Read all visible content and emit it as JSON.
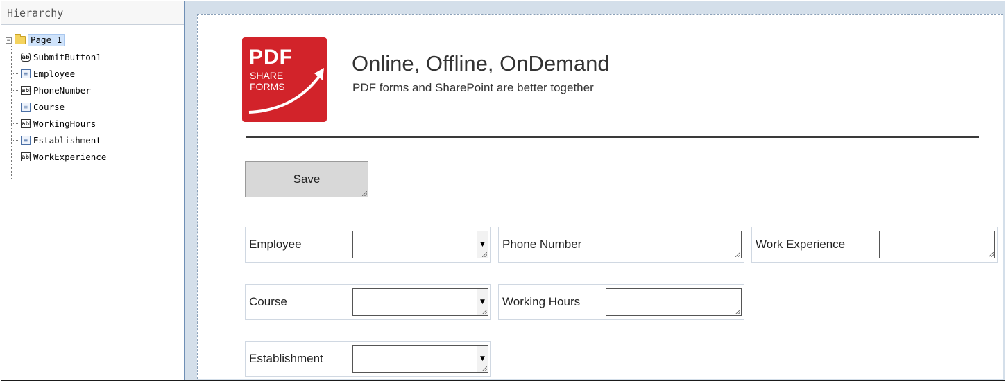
{
  "hierarchy": {
    "title": "Hierarchy",
    "root": {
      "label": "Page 1",
      "toggle": "−"
    },
    "items": [
      {
        "label": "SubmitButton1",
        "icon": "button-icon",
        "glyph": "ab"
      },
      {
        "label": "Employee",
        "icon": "dropdown-icon",
        "glyph": "≡"
      },
      {
        "label": "PhoneNumber",
        "icon": "textbox-icon",
        "glyph": "abl"
      },
      {
        "label": "Course",
        "icon": "dropdown-icon",
        "glyph": "≡"
      },
      {
        "label": "WorkingHours",
        "icon": "textbox-icon",
        "glyph": "abl"
      },
      {
        "label": "Establishment",
        "icon": "dropdown-icon",
        "glyph": "≡"
      },
      {
        "label": "WorkExperience",
        "icon": "textbox-icon",
        "glyph": "abl"
      }
    ]
  },
  "logo": {
    "line1": "PDF",
    "line2": "SHARE",
    "line3": "FORMS",
    "color": "#d2232a"
  },
  "header": {
    "title": "Online, Offline, OnDemand",
    "subtitle": "PDF forms and SharePoint are better together"
  },
  "form": {
    "save_label": "Save",
    "fields": {
      "employee": {
        "label": "Employee",
        "type": "dropdown",
        "value": "",
        "arrow": "▼"
      },
      "phone": {
        "label": "Phone Number",
        "type": "text",
        "value": ""
      },
      "work_experience": {
        "label": "Work Experience",
        "type": "text",
        "value": ""
      },
      "course": {
        "label": "Course",
        "type": "dropdown",
        "value": "",
        "arrow": "▼"
      },
      "working_hours": {
        "label": "Working Hours",
        "type": "text",
        "value": ""
      },
      "establishment": {
        "label": "Establishment",
        "type": "dropdown",
        "value": "",
        "arrow": "▼"
      }
    }
  }
}
